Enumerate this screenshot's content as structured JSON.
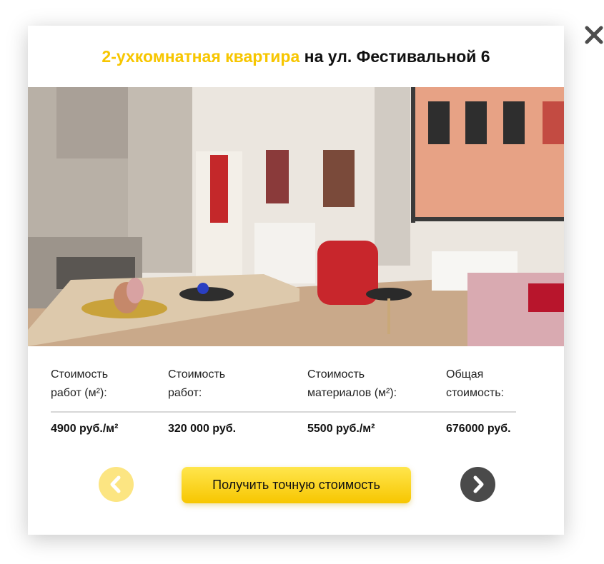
{
  "colors": {
    "accent": "#f7c600",
    "dark_button": "#4a4a4a",
    "prev_button": "#fce582"
  },
  "header": {
    "title_highlight": "2-ухкомнатная квартира",
    "title_rest": " на ул. Фестивальной 6"
  },
  "carousel": {
    "slide_count": 4,
    "active_index": 0
  },
  "info": {
    "columns": [
      {
        "label_line1": "Стоимость",
        "label_line2": "работ (м²):",
        "value": "4900 руб./м²"
      },
      {
        "label_line1": "Стоимость",
        "label_line2": "работ:",
        "value": "320 000 руб."
      },
      {
        "label_line1": "Стоимость",
        "label_line2": "материалов (м²):",
        "value": "5500 руб./м²"
      },
      {
        "label_line1": "Общая",
        "label_line2": "стоимость:",
        "value": "676000 руб."
      }
    ]
  },
  "actions": {
    "cta_label": "Получить точную стоимость",
    "prev_icon": "chevron-left-icon",
    "next_icon": "chevron-right-icon",
    "close_icon": "close-icon"
  }
}
